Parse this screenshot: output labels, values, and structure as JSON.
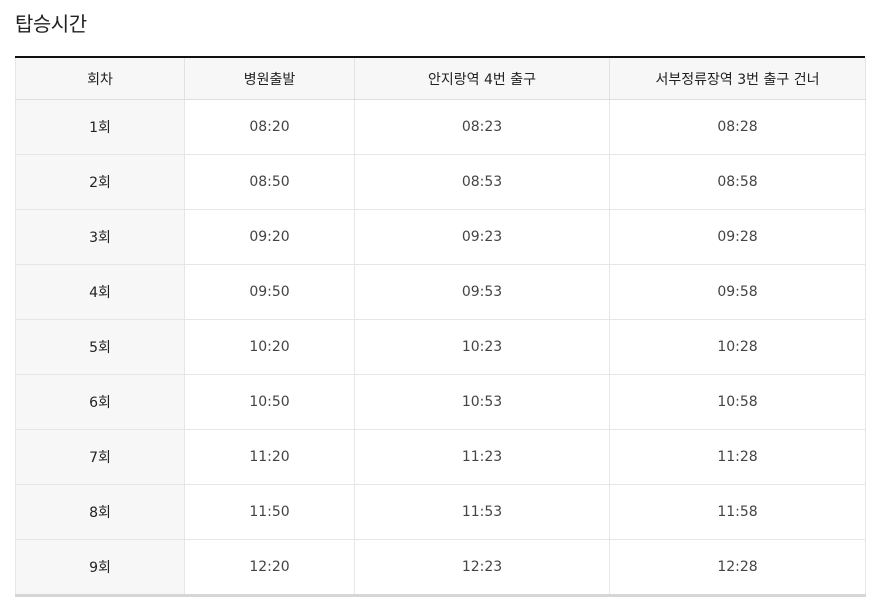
{
  "title": "탑승시간",
  "table": {
    "headers": [
      "회차",
      "병원출발",
      "안지랑역 4번 출구",
      "서부정류장역 3번 출구 건너"
    ],
    "rows": [
      [
        "1회",
        "08:20",
        "08:23",
        "08:28"
      ],
      [
        "2회",
        "08:50",
        "08:53",
        "08:58"
      ],
      [
        "3회",
        "09:20",
        "09:23",
        "09:28"
      ],
      [
        "4회",
        "09:50",
        "09:53",
        "09:58"
      ],
      [
        "5회",
        "10:20",
        "10:23",
        "10:28"
      ],
      [
        "6회",
        "10:50",
        "10:53",
        "10:58"
      ],
      [
        "7회",
        "11:20",
        "11:23",
        "11:28"
      ],
      [
        "8회",
        "11:50",
        "11:53",
        "11:58"
      ],
      [
        "9회",
        "12:20",
        "12:23",
        "12:28"
      ]
    ]
  }
}
